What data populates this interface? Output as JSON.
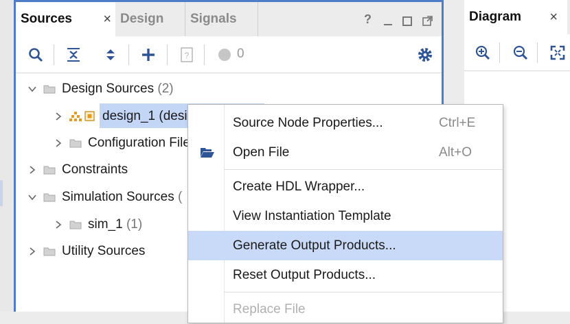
{
  "sources_panel": {
    "tabs": [
      {
        "label": "Sources",
        "active": true
      },
      {
        "label": "Design",
        "active": false
      },
      {
        "label": "Signals",
        "active": false
      }
    ],
    "close_glyph": "×",
    "help_glyph": "?",
    "window_controls": [
      "minimize-icon",
      "maximize-icon",
      "float-icon"
    ],
    "toolbar": {
      "icons": [
        "search-icon",
        "collapse-all-icon",
        "expand-all-icon",
        "add-icon",
        "properties-icon",
        "status-icon"
      ],
      "count": "0"
    },
    "tree": [
      {
        "label": "Design Sources",
        "count": "(2)",
        "expanded": true,
        "level": 0
      },
      {
        "label": "design_1 (desi",
        "level": 1,
        "selected": true
      },
      {
        "label": "Configuration File",
        "level": 1
      },
      {
        "label": "Constraints",
        "level": 0
      },
      {
        "label": "Simulation Sources",
        "count": "(",
        "expanded": true,
        "level": 0
      },
      {
        "label": "sim_1",
        "count": "(1)",
        "level": 1
      },
      {
        "label": "Utility Sources",
        "level": 0
      }
    ]
  },
  "diagram_panel": {
    "tab": {
      "label": "Diagram"
    },
    "close_glyph": "×",
    "toolbar_icons": [
      "zoom-in-icon",
      "zoom-out-icon",
      "fit-view-icon"
    ]
  },
  "context_menu": {
    "items": [
      {
        "label": "Source Node Properties...",
        "shortcut": "Ctrl+E"
      },
      {
        "label": "Open File",
        "shortcut": "Alt+O",
        "icon": "open-folder-icon"
      },
      {
        "label": "Create HDL Wrapper..."
      },
      {
        "label": "View Instantiation Template"
      },
      {
        "label": "Generate Output Products...",
        "highlighted": true
      },
      {
        "label": "Reset Output Products..."
      },
      {
        "label": "Replace File",
        "disabled": true
      }
    ]
  },
  "colors": {
    "panel_border": "#4f7cc7",
    "selection": "#c4d6f6",
    "menu_highlight": "#c9daf8",
    "icon_blue": "#2f5597"
  }
}
